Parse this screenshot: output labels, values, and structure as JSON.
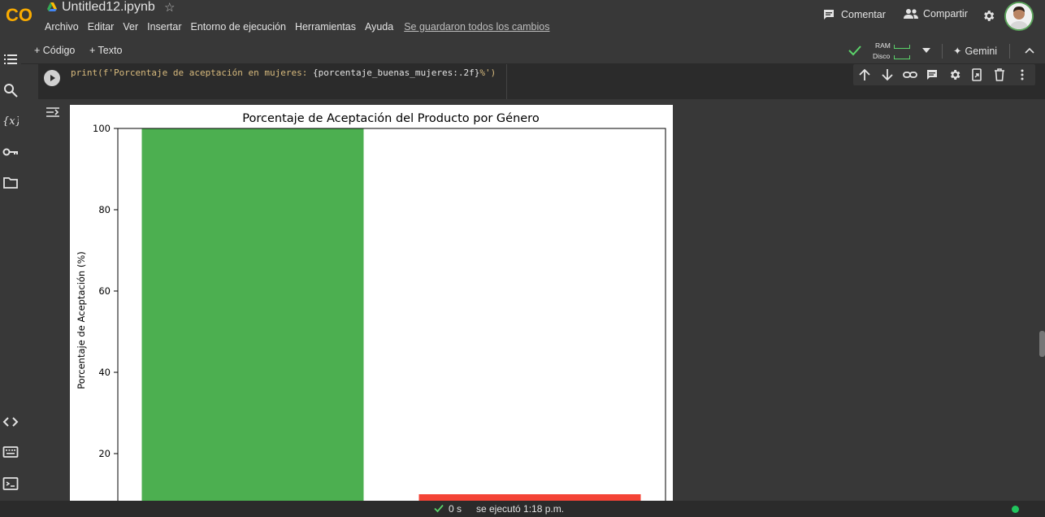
{
  "header": {
    "title": "Untitled12.ipynb",
    "logo_text": "CO",
    "menu": [
      "Archivo",
      "Editar",
      "Ver",
      "Insertar",
      "Entorno de ejecución",
      "Herramientas",
      "Ayuda"
    ],
    "saved_status": "Se guardaron todos los cambios",
    "comment_label": "Comentar",
    "share_label": "Compartir"
  },
  "toolbar": {
    "add_code": "+ Código",
    "add_text": "+ Texto",
    "ram_label": "RAM",
    "disk_label": "Disco",
    "gemini_label": "Gemini"
  },
  "cell": {
    "code_prefix": "print(f'Porcentaje de aceptación en mujeres: ",
    "code_expr": "{porcentaje_buenas_mujeres:.2f}",
    "code_suffix": "%')"
  },
  "status": {
    "duration": "0 s",
    "executed": "se ejecutó 1:18 p.m."
  },
  "colors": {
    "bar_1": "#4caf50",
    "bar_2": "#f44336",
    "run_ok": "#21c55d"
  },
  "chart_data": {
    "type": "bar",
    "title": "Porcentaje de Aceptación del Producto por Género",
    "ylabel": "Porcentaje de Aceptación (%)",
    "xlabel": "",
    "ylim": [
      0,
      100
    ],
    "yticks": [
      20,
      40,
      60,
      80,
      100
    ],
    "values": [
      100,
      10
    ],
    "categories": [
      "",
      ""
    ],
    "colors": [
      "#4caf50",
      "#f44336"
    ],
    "grid": false
  }
}
